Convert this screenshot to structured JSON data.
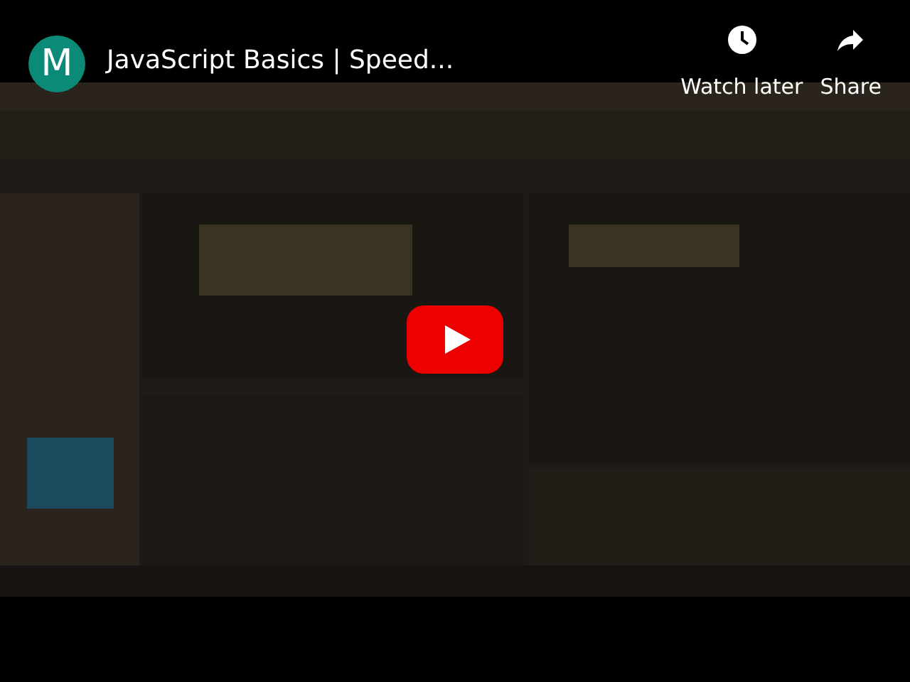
{
  "channel": {
    "avatar_letter": "M"
  },
  "title": "JavaScript Basics | Speed...",
  "actions": [
    {
      "kind": "clock",
      "label": "Watch later"
    },
    {
      "kind": "share",
      "label": "Share"
    }
  ]
}
